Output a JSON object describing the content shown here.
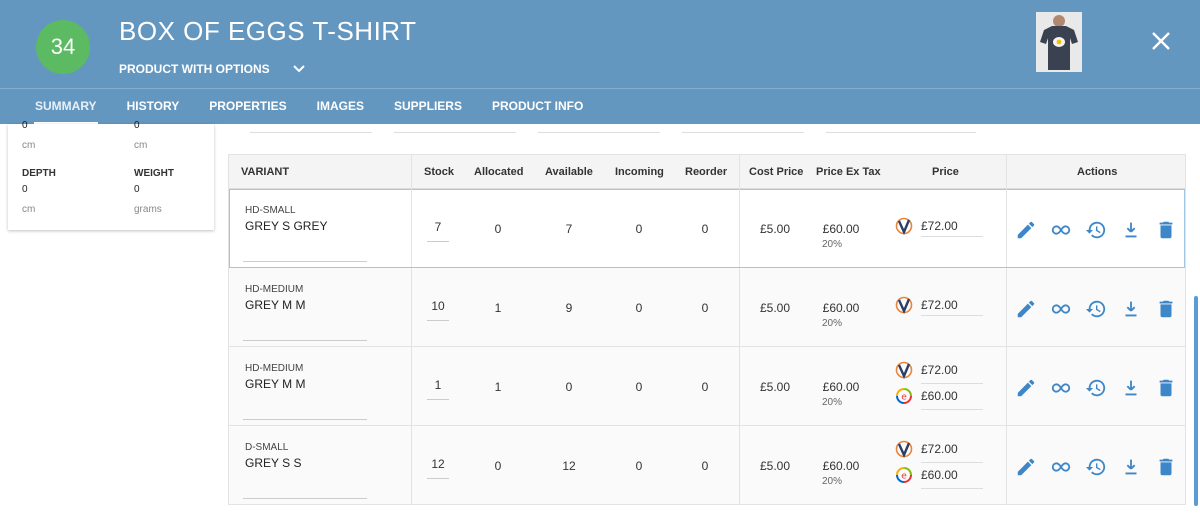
{
  "header": {
    "badge": "34",
    "title": "BOX OF EGGS T-SHIRT",
    "subtitle": "PRODUCT WITH OPTIONS",
    "colors": {
      "bar": "#6497bf",
      "badge": "#5cba63",
      "action": "#3d87c8"
    }
  },
  "tabs": [
    {
      "label": "SUMMARY",
      "active": true
    },
    {
      "label": "HISTORY"
    },
    {
      "label": "PROPERTIES"
    },
    {
      "label": "IMAGES"
    },
    {
      "label": "SUPPLIERS"
    },
    {
      "label": "PRODUCT INFO"
    }
  ],
  "card": {
    "top_left_value": "0",
    "top_left_unit": "cm",
    "top_right_value": "0",
    "top_right_unit": "cm",
    "depth_label": "DEPTH",
    "depth_value": "0",
    "depth_unit": "cm",
    "weight_label": "WEIGHT",
    "weight_value": "0",
    "weight_unit": "grams"
  },
  "table": {
    "headers": {
      "variant": "VARIANT",
      "stock": "Stock",
      "allocated": "Allocated",
      "available": "Available",
      "incoming": "Incoming",
      "reorder": "Reorder",
      "cost": "Cost Price",
      "ex_tax": "Price Ex Tax",
      "price": "Price",
      "actions": "Actions"
    },
    "rows": [
      {
        "sku": "HD-SMALL",
        "name": "GREY S GREY",
        "stock": "7",
        "allocated": "0",
        "available": "7",
        "incoming": "0",
        "reorder": "0",
        "cost": "£5.00",
        "ex_tax": "£60.00",
        "tax": "20%",
        "price1": "£72.00",
        "price2": ""
      },
      {
        "sku": "HD-MEDIUM",
        "name": "GREY M M",
        "stock": "10",
        "allocated": "1",
        "available": "9",
        "incoming": "0",
        "reorder": "0",
        "cost": "£5.00",
        "ex_tax": "£60.00",
        "tax": "20%",
        "price1": "£72.00",
        "price2": ""
      },
      {
        "sku": "HD-MEDIUM",
        "name": "GREY M M",
        "stock": "1",
        "allocated": "1",
        "available": "0",
        "incoming": "0",
        "reorder": "0",
        "cost": "£5.00",
        "ex_tax": "£60.00",
        "tax": "20%",
        "price1": "£72.00",
        "price2": "£60.00"
      },
      {
        "sku": "D-SMALL",
        "name": "GREY S S",
        "stock": "12",
        "allocated": "0",
        "available": "12",
        "incoming": "0",
        "reorder": "0",
        "cost": "£5.00",
        "ex_tax": "£60.00",
        "tax": "20%",
        "price1": "£72.00",
        "price2": "£60.00"
      }
    ]
  },
  "icons": {
    "actions": [
      "pencil-icon",
      "link-icon",
      "history-icon",
      "download-icon",
      "trash-icon"
    ],
    "channels": [
      "v-channel-icon",
      "e-channel-icon"
    ]
  }
}
